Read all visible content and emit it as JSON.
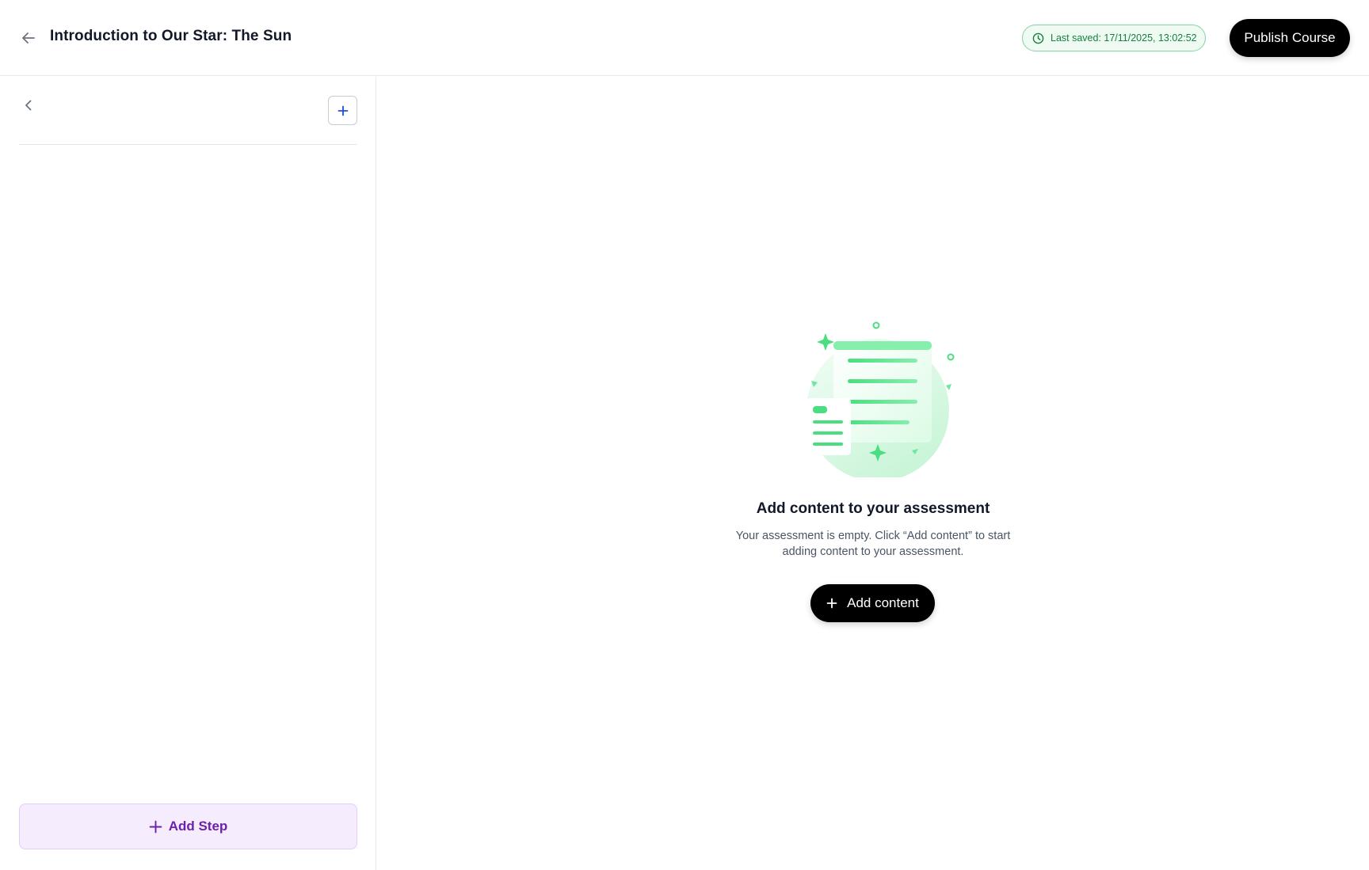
{
  "header": {
    "title": "Introduction to Our Star: The Sun",
    "last_saved": "Last saved: 17/11/2025, 13:02:52",
    "publish_label": "Publish Course"
  },
  "sidebar": {
    "add_step_label": "Add Step"
  },
  "main": {
    "empty_title": "Add content to your assessment",
    "empty_description": "Your assessment is empty. Click “Add content” to start adding content to your assessment.",
    "add_content_label": "Add content"
  },
  "icons": {
    "back": "arrow-left-icon",
    "clock": "clock-icon",
    "collapse": "chevron-left-icon",
    "add": "plus-icon",
    "illustration": "document-illustration"
  },
  "colors": {
    "accent_green": "#4ade80",
    "saved_text": "#15803d",
    "add_step_purple": "#6b21a8",
    "primary_black": "#000000"
  }
}
